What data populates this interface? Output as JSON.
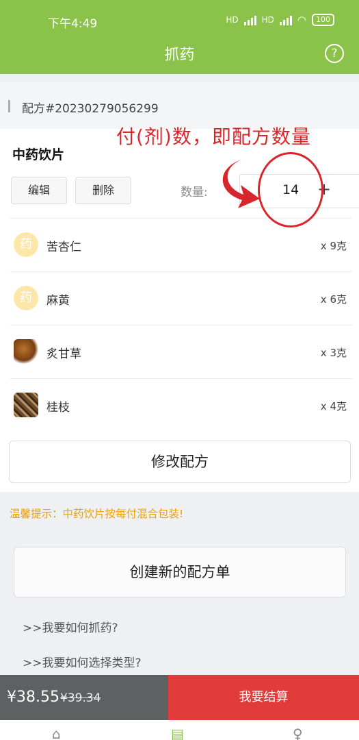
{
  "status": {
    "time": "下午4:49",
    "hd1": "HD",
    "hd2": "HD",
    "battery": "100"
  },
  "header": {
    "title": "抓药",
    "help_icon": "question-circle-icon"
  },
  "recipe": {
    "id_label": "配方#20230279056299"
  },
  "section": {
    "title": "中药饮片",
    "edit_label": "编辑",
    "delete_label": "删除",
    "qty_label": "数量:",
    "qty_value": "14",
    "plus_label": "+"
  },
  "items": [
    {
      "name": "苦杏仁",
      "amount": "x 9克",
      "icon": "药"
    },
    {
      "name": "麻黄",
      "amount": "x 6克",
      "icon": "药"
    },
    {
      "name": "炙甘草",
      "amount": "x 3克",
      "icon": "herb-photo"
    },
    {
      "name": "桂枝",
      "amount": "x 4克",
      "icon": "herb-photo"
    }
  ],
  "modify_label": "修改配方",
  "tip": "温馨提示：中药饮片按每付混合包装!",
  "create_label": "创建新的配方单",
  "faq": [
    ">>我要如何抓药?",
    ">>我要如何选择类型?"
  ],
  "footer": {
    "price": "¥38.55",
    "original_price": "¥39.34",
    "checkout_label": "我要结算"
  },
  "annotation": {
    "text": "付(剂)数，即配方数量"
  },
  "colors": {
    "header": "#8bc34a",
    "checkout": "#e13b3b",
    "price_bar": "#5f6062",
    "tip": "#f0a000",
    "annotation": "#d8262c"
  }
}
